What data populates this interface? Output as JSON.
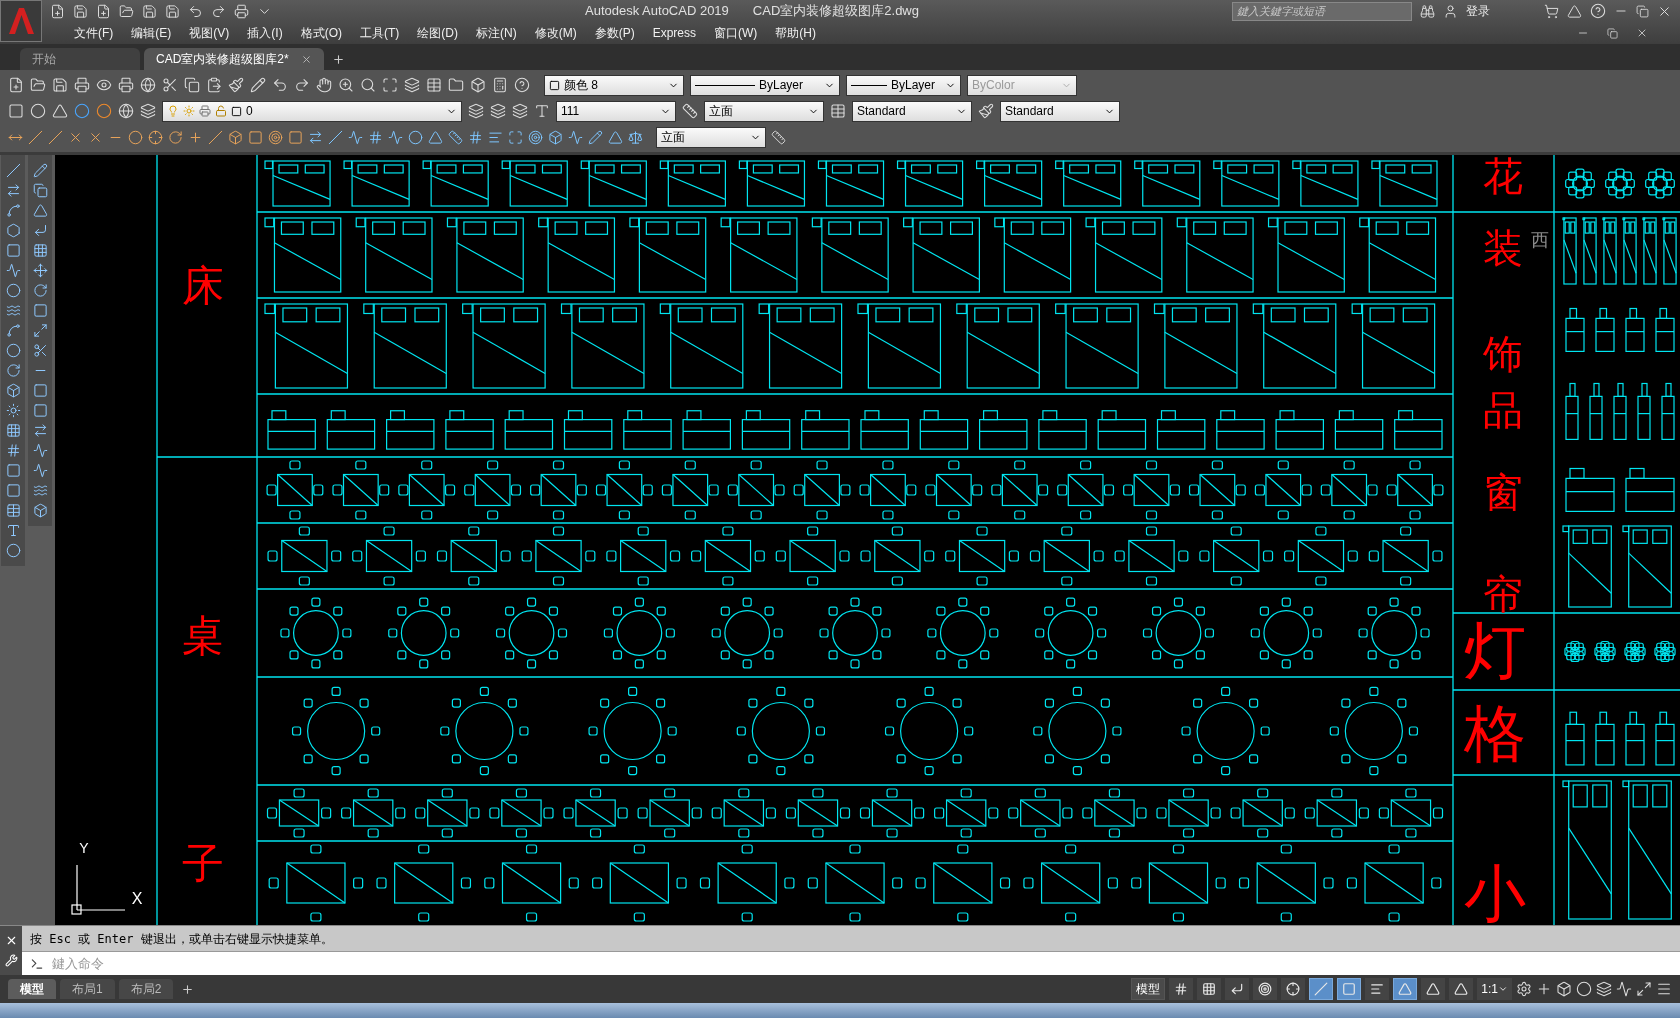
{
  "window": {
    "app_title": "Autodesk AutoCAD 2019",
    "document_title": "CAD室内装修超级图库2.dwg"
  },
  "search": {
    "placeholder": "鍵入关鍵字或短语"
  },
  "account": {
    "label": "登录"
  },
  "menu": [
    "文件(F)",
    "编辑(E)",
    "视图(V)",
    "插入(I)",
    "格式(O)",
    "工具(T)",
    "绘图(D)",
    "标注(N)",
    "修改(M)",
    "参数(P)",
    "Express",
    "窗口(W)",
    "帮助(H)"
  ],
  "doc_tabs": [
    {
      "label": "开始",
      "selected": false
    },
    {
      "label": "CAD室内装修超级图库2*",
      "selected": true
    }
  ],
  "properties": {
    "color_setting": "颜色 8",
    "linetype": "ByLayer",
    "lineweight": "ByLayer",
    "plotstyle": {
      "value": "ByColor",
      "disabled": true
    }
  },
  "layer": {
    "value": "0"
  },
  "styles": {
    "text_style": "111",
    "dim_style": "立面",
    "table_style": "Standard",
    "mleader_style": "Standard"
  },
  "dim_toolbar": {
    "dim_style": "立面"
  },
  "drawing": {
    "left_labels": [
      "床",
      "桌",
      "子"
    ],
    "right_labels": [
      "花",
      "装",
      "饰",
      "品",
      "窗",
      "帘",
      "灯",
      "格",
      "小"
    ],
    "faded_label": "西",
    "ucs": {
      "y": "Y",
      "x": "X"
    }
  },
  "command": {
    "history": "按 Esc 或 Enter 键退出，或单击右键显示快捷菜单。",
    "placeholder": "鍵入命令"
  },
  "layout_tabs": [
    {
      "label": "模型",
      "selected": true
    },
    {
      "label": "布局1",
      "selected": false
    },
    {
      "label": "布局2",
      "selected": false
    }
  ],
  "status": {
    "space": "模型",
    "scale": "1:1",
    "toggles": [
      {
        "on": false
      },
      {
        "on": false
      },
      {
        "on": false
      },
      {
        "on": false
      },
      {
        "on": false
      },
      {
        "on": true
      },
      {
        "on": true
      },
      {
        "on": false
      },
      {
        "on": true
      },
      {
        "on": false
      },
      {
        "on": false
      }
    ]
  }
}
